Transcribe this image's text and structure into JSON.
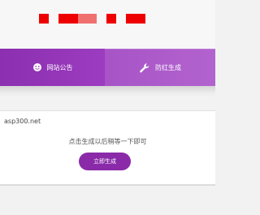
{
  "nav": {
    "items": [
      {
        "label": "网站公告",
        "icon": "smiley-icon"
      },
      {
        "label": "防红生成",
        "icon": "wrench-icon"
      }
    ]
  },
  "main": {
    "site_url": "asp300.net",
    "hint": "点击生成以后稍等一下即可",
    "button_label": "立即生成"
  },
  "colors": {
    "nav_gradient_start": "#8c2fb0",
    "nav_gradient_end": "#a84ec8",
    "button": "#8a2aa8",
    "block_red": "#ee0000",
    "block_pink": "#f07070"
  }
}
